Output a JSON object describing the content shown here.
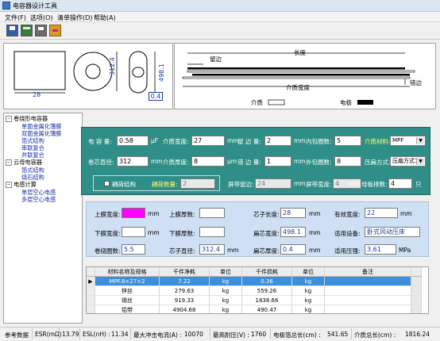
{
  "window": {
    "title": "电容器设计工具"
  },
  "menu": [
    "文件(F)",
    "选项(O)",
    "清单操作(D)",
    "帮助(A)"
  ],
  "toolbar": {
    "icons": [
      "save-icon",
      "calc-icon",
      "print-icon",
      "tools-icon"
    ]
  },
  "drawing": {
    "rect_width": "28",
    "circle_dim": "312.4",
    "oval_height": "498.1",
    "oval_width": "0.4",
    "length_label": "长度",
    "leave_edge_label": "留边",
    "wrong_edge_label": "错边",
    "medium_width_label": "介质宽度",
    "legend_medium": "介质",
    "legend_electrode": "电极"
  },
  "tree": {
    "groups": [
      {
        "label": "卷绕形电容器",
        "children": [
          "单面金属化薄膜",
          "双面金属化薄膜",
          "箔式结构",
          "串联复合",
          "并联复合"
        ]
      },
      {
        "label": "云母电容器",
        "children": [
          "箔式结构",
          "烧石结构"
        ]
      },
      {
        "label": "电感计算",
        "children": [
          "单层空心电感",
          "多层空心电感"
        ]
      }
    ]
  },
  "params": {
    "capacitance_label": "电 容 量:",
    "capacitance_value": "0.58",
    "capacitance_unit": "μF",
    "medium_width_label": "介质宽度:",
    "medium_width_value": "27",
    "medium_width_unit": "mm",
    "leave_edge_label": "留 边 量:",
    "leave_edge_value": "2",
    "leave_edge_unit": "mm",
    "inner_wrap_label": "内包圈数:",
    "inner_wrap_value": "5",
    "medium_material_label": "介质材料:",
    "medium_material_value": "MPF",
    "core_diameter_label": "卷芯直径:",
    "core_diameter_value": "312",
    "core_diameter_unit": "mm",
    "medium_thickness_label": "介质厚度:",
    "medium_thickness_value": "8",
    "medium_thickness_unit": "μm",
    "wrong_edge_label": "错 边 量:",
    "wrong_edge_value": "1",
    "wrong_edge_unit": "mm",
    "outer_wrap_label": "外包圈数:",
    "outer_wrap_value": "8",
    "press_mode_label": "压扁方式:",
    "press_mode_value": "压扁方式1",
    "coupled_label": "耦荷结构",
    "coupled_count_label": "耦荷数量:",
    "coupled_count_value": "2",
    "screen_edge_label": "屏带留边:",
    "screen_edge_value": "24",
    "screen_edge_unit": "mm",
    "screen_width_label": "屏带宽度:",
    "screen_width_value": "4",
    "screen_width_unit": "mm",
    "parent_rows_label": "母板排数:",
    "parent_rows_value": "4",
    "parent_rows_unit": "只"
  },
  "results": {
    "upper_film_width_label": "上膜宽度:",
    "upper_film_width_unit": "mm",
    "upper_film_color": "#ff00ff",
    "upper_film_thick_label": "上膜厚数:",
    "core_length_label": "芯子长度:",
    "core_length_value": "28",
    "core_length_unit": "mm",
    "effective_width_label": "有效宽度:",
    "effective_width_value": "22",
    "effective_width_unit": "mm",
    "lower_film_width_label": "下膜宽度:",
    "lower_film_width_unit": "mm",
    "lower_film_thick_label": "下膜厚数:",
    "flat_width_label": "扁芯宽度:",
    "flat_width_value": "498.1",
    "flat_width_unit": "mm",
    "device_label": "适用设备:",
    "device_value": "卧式风动压床",
    "winding_turns_label": "卷绕圈数:",
    "winding_turns_value": "5.5",
    "core_diameter_label": "芯子直径:",
    "core_diameter_value": "312.4",
    "core_diameter_unit": "mm",
    "flat_thickness_label": "扁芯厚度:",
    "flat_thickness_value": "0.4",
    "flat_thickness_unit": "mm",
    "pressure_label": "适用压强:",
    "pressure_value": "3.61",
    "pressure_unit": "MPa"
  },
  "table": {
    "headers": [
      "材料名称及规格",
      "千件净耗",
      "单位",
      "千件损耗",
      "单位",
      "备注"
    ],
    "rows": [
      [
        "MPF.8×27×2",
        "7.22",
        "kg",
        "0.36",
        "kg",
        ""
      ],
      [
        "锌丝",
        "279.63",
        "kg",
        "559.26",
        "kg",
        ""
      ],
      [
        "锡丝",
        "919.33",
        "kg",
        "1838.66",
        "kg",
        ""
      ],
      [
        "铝带",
        "4904.68",
        "kg",
        "490.47",
        "kg",
        ""
      ]
    ]
  },
  "status": {
    "items": [
      "参考数据",
      "ESR(mΩ)",
      "13.79",
      "ESL(nH) :",
      "11.34",
      "最大冲击电流(A) :",
      "10070",
      "最高耐压(V) :",
      "1760",
      "电极箔总长(cm) :",
      "541.65",
      "介质总长(cm) :",
      "1816.24"
    ]
  }
}
